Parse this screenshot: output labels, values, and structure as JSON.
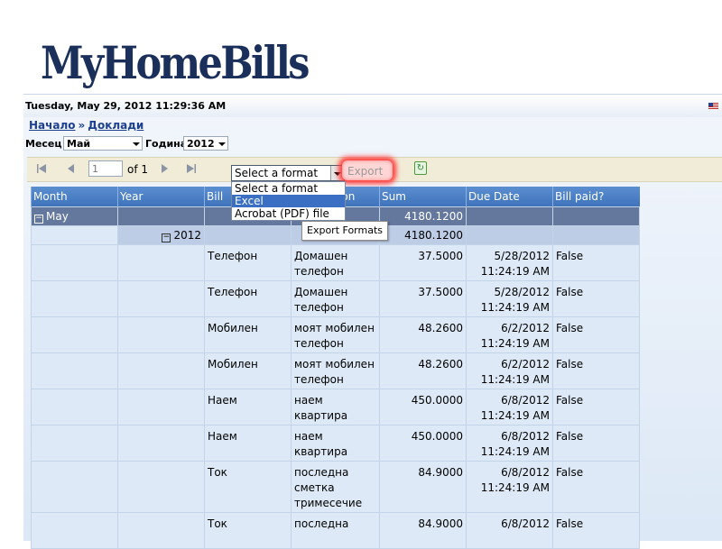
{
  "header": {
    "logo": "MyHomeBills",
    "datetime": "Tuesday, May 29, 2012 11:29:36 AM"
  },
  "breadcrumb": {
    "home": "Начало",
    "separator": "»",
    "current": "Доклади"
  },
  "filters": {
    "month_label": "Месец",
    "month_value": "Май",
    "year_label": "Година",
    "year_value": "2012"
  },
  "toolbar": {
    "page_value": "1",
    "of_text": "of 1",
    "format_selected": "Select a format",
    "export_label": "Export",
    "format_options": [
      "Select a format",
      "Excel",
      "Acrobat (PDF) file"
    ],
    "tooltip": "Export Formats"
  },
  "table": {
    "columns": [
      "Month",
      "Year",
      "Bill",
      "Description",
      "Sum",
      "Due Date",
      "Bill paid?"
    ],
    "group_month": {
      "label": "May",
      "sum": "4180.1200"
    },
    "group_year": {
      "label": "2012",
      "sum": "4180.1200"
    },
    "rows": [
      {
        "bill": "Телефон",
        "desc": "Домашен телефон",
        "sum": "37.5000",
        "due": "5/28/2012 11:24:19 AM",
        "paid": "False"
      },
      {
        "bill": "Телефон",
        "desc": "Домашен телефон",
        "sum": "37.5000",
        "due": "5/28/2012 11:24:19 AM",
        "paid": "False"
      },
      {
        "bill": "Мобилен",
        "desc": "моят мобилен телефон",
        "sum": "48.2600",
        "due": "6/2/2012 11:24:19 AM",
        "paid": "False"
      },
      {
        "bill": "Мобилен",
        "desc": "моят мобилен телефон",
        "sum": "48.2600",
        "due": "6/2/2012 11:24:19 AM",
        "paid": "False"
      },
      {
        "bill": "Наем",
        "desc": "наем квартира",
        "sum": "450.0000",
        "due": "6/8/2012 11:24:19 AM",
        "paid": "False"
      },
      {
        "bill": "Наем",
        "desc": "наем квартира",
        "sum": "450.0000",
        "due": "6/8/2012 11:24:19 AM",
        "paid": "False"
      },
      {
        "bill": "Ток",
        "desc": "последна сметка тримесечие",
        "sum": "84.9000",
        "due": "6/8/2012 11:24:19 AM",
        "paid": "False"
      },
      {
        "bill": "Ток",
        "desc": "последна",
        "sum": "84.9000",
        "due": "6/8/2012",
        "paid": "False"
      }
    ]
  }
}
